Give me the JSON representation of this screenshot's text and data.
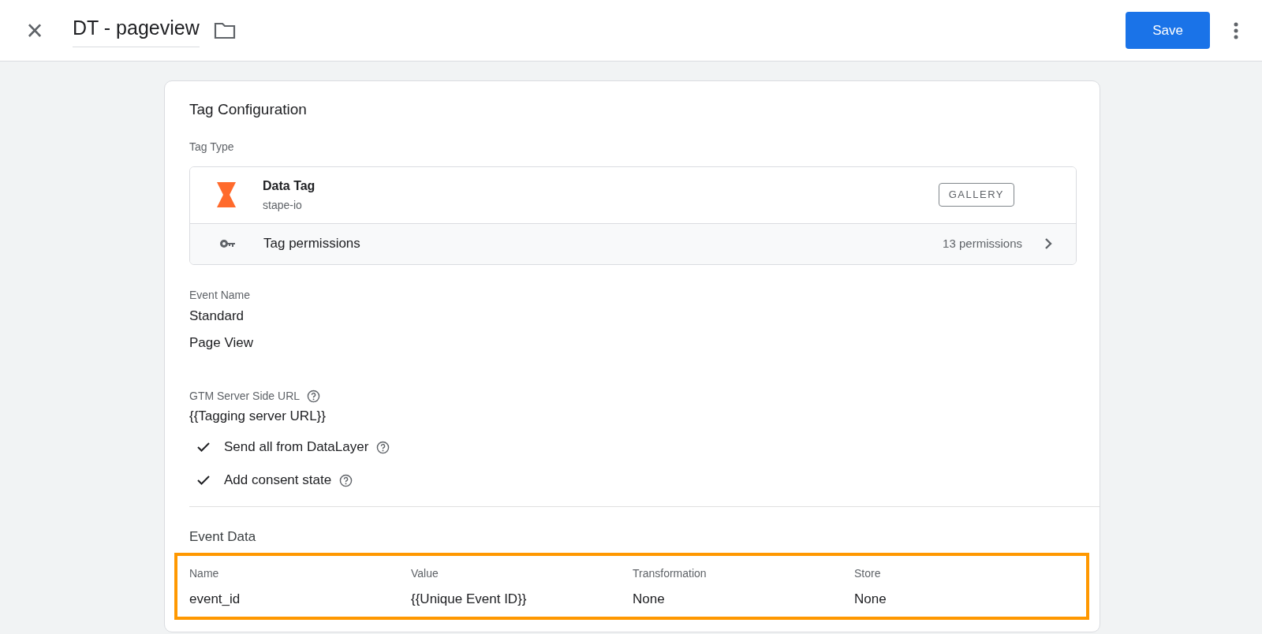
{
  "header": {
    "close": "×",
    "title": "DT - pageview",
    "save": "Save"
  },
  "card": {
    "title": "Tag Configuration",
    "tag_type": {
      "label": "Tag Type",
      "name": "Data Tag",
      "vendor": "stape-io",
      "gallery": "GALLERY",
      "permissions_label": "Tag permissions",
      "permissions_count": "13 permissions"
    },
    "event_name": {
      "label": "Event Name",
      "values": [
        "Standard",
        "Page View"
      ]
    },
    "server_url": {
      "label": "GTM Server Side URL",
      "value": "{{Tagging server URL}}"
    },
    "options": [
      {
        "label": "Send all from DataLayer",
        "checked": true
      },
      {
        "label": "Add consent state",
        "checked": true
      }
    ],
    "event_data": {
      "title": "Event Data",
      "highlighted": true,
      "columns": [
        "Name",
        "Value",
        "Transformation",
        "Store"
      ],
      "rows": [
        [
          "event_id",
          "{{Unique Event ID}}",
          "None",
          "None"
        ]
      ]
    }
  }
}
